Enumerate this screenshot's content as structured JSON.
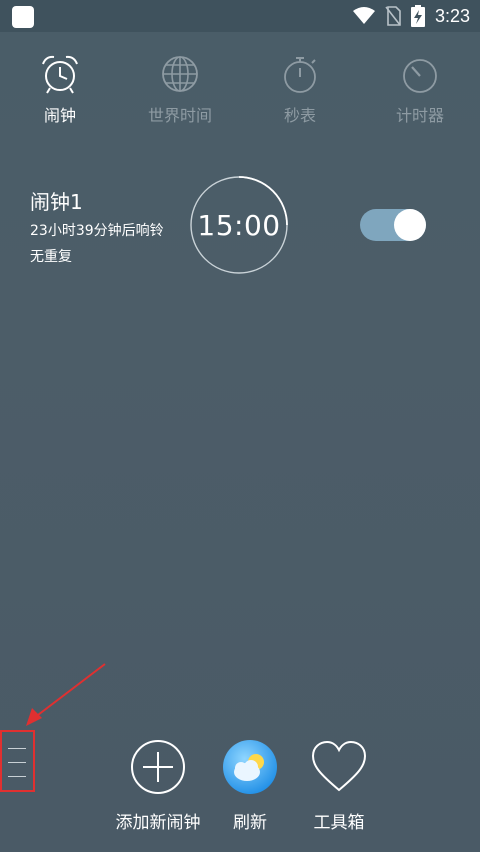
{
  "status_bar": {
    "time": "3:23",
    "icons": [
      "wifi-icon",
      "no-sim-icon",
      "battery-charging-icon"
    ]
  },
  "tabs": [
    {
      "label": "闹钟",
      "icon": "alarm-clock-icon",
      "active": true
    },
    {
      "label": "世界时间",
      "icon": "globe-icon",
      "active": false
    },
    {
      "label": "秒表",
      "icon": "stopwatch-icon",
      "active": false
    },
    {
      "label": "计时器",
      "icon": "timer-icon",
      "active": false
    }
  ],
  "alarm": {
    "name": "闹钟1",
    "remaining": "23小时39分钟后响铃",
    "repeat": "无重复",
    "time": "15:00",
    "enabled": true
  },
  "bottom_actions": [
    {
      "label": "添加新闹钟",
      "icon": "plus-circle-icon"
    },
    {
      "label": "刷新",
      "icon": "weather-refresh-icon"
    },
    {
      "label": "工具箱",
      "icon": "heart-icon"
    }
  ],
  "colors": {
    "background": "#4a5d68",
    "toggle_track": "#7fa6be",
    "annotation": "#e03030",
    "inactive_tab": "#8e9ba3"
  }
}
